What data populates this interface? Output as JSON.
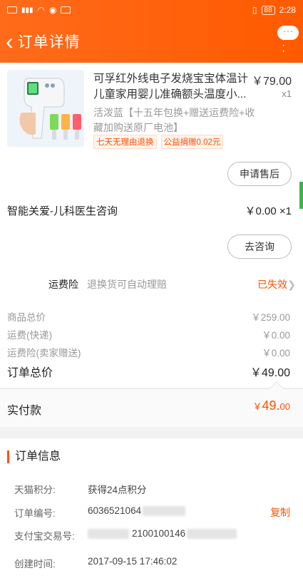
{
  "status_bar": {
    "time": "2:28",
    "battery": "88"
  },
  "header": {
    "back_symbol": "‹",
    "title": "订单详情",
    "more_badge": "···"
  },
  "product": {
    "title": "可孚红外线电子发烧宝宝体温计儿童家用婴儿准确额头温度小...",
    "price": "￥79.00",
    "quantity": "x1",
    "sku": "活泼蓝【十五年包换+赠送运费险+收藏加购送原厂电池】",
    "tags": [
      "七天无理由退换",
      "公益捐赠0.02元"
    ],
    "after_sale_button": "申请售后"
  },
  "service": {
    "name": "智能关爱-儿科医生咨询",
    "price_qty": "￥0.00 ×1",
    "consult_button": "去咨询"
  },
  "insurance": {
    "label": "运费险",
    "desc": "退换货可自动理赔",
    "status": "已失效"
  },
  "summary": {
    "rows": [
      {
        "label": "商品总价",
        "value": "￥259.00"
      },
      {
        "label": "运费(快递)",
        "value": "￥0.00"
      },
      {
        "label": "运费险(卖家赠送)",
        "value": "￥0.00"
      }
    ],
    "total_label": "订单总价",
    "total_value": "￥49.00"
  },
  "paid": {
    "label": "实付款",
    "currency": "￥",
    "amount": "49.",
    "cents": "00"
  },
  "order_info": {
    "title": "订单信息",
    "points_label": "天猫积分:",
    "points_value": "获得24点积分",
    "order_no_label": "订单编号:",
    "order_no_value": "6036521064",
    "copy_label": "复制",
    "alipay_label": "支付宝交易号:",
    "alipay_value": "2100100146",
    "created_label": "创建时间:",
    "created_value": "2017-09-15 17:46:02"
  },
  "colors": {
    "accent": "#ff5000",
    "header": "#ff6b1a"
  }
}
